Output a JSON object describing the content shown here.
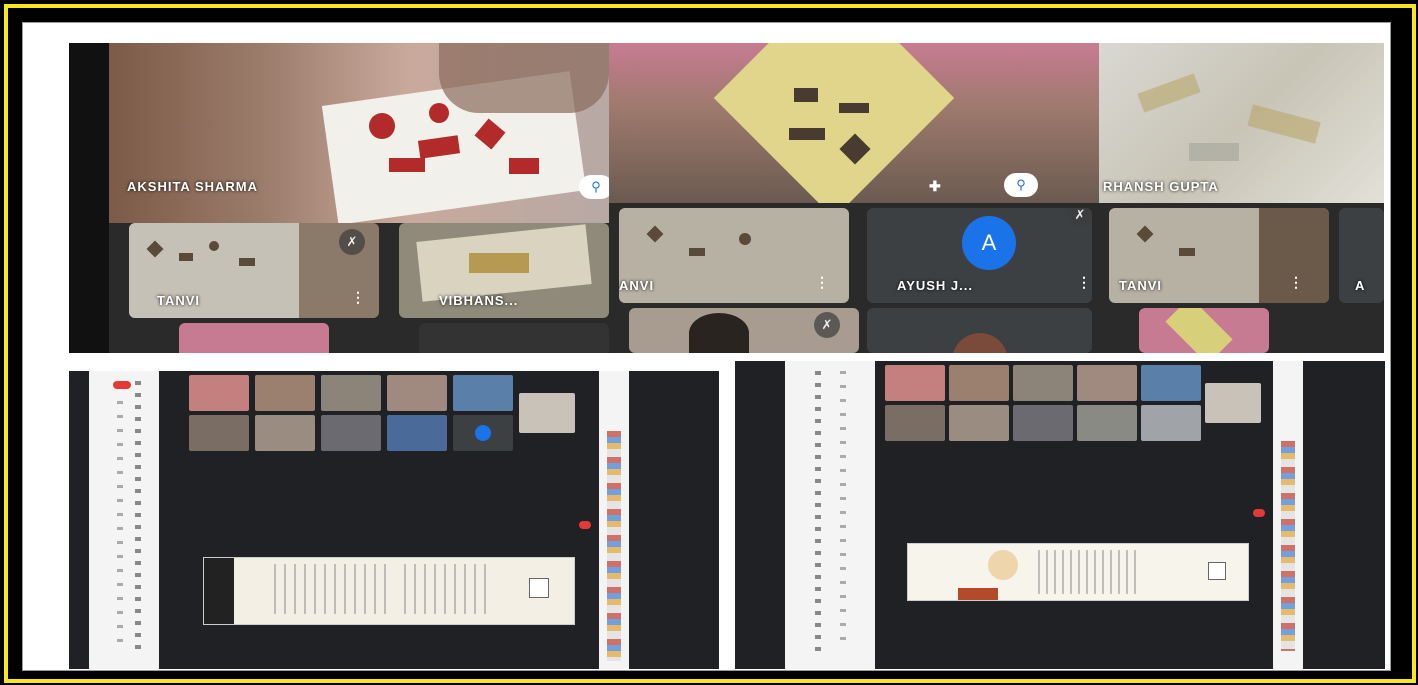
{
  "participants_top": {
    "main1_name": "AKSHITA SHARMA",
    "main3_name": "RHANSH GUPTA",
    "tile_tanvi_1": "TANVI",
    "tile_vibhans": "VIBHANS...",
    "tile_tanvi_2": "ANVI",
    "tile_ayush": "AYUSH J...",
    "tile_tanvi_3": "TANVI",
    "tile_a_cut": "A",
    "ayush_initial": "A"
  },
  "icons": {
    "pin": "pin-icon",
    "more": "more-vert-icon",
    "mic_off": "mic-off-icon",
    "pip": "picture-in-picture-icon"
  },
  "colors": {
    "border_yellow": "#f7e51d",
    "meet_dark": "#202124",
    "accent_blue": "#1a73e8",
    "record_red": "#e53935"
  }
}
